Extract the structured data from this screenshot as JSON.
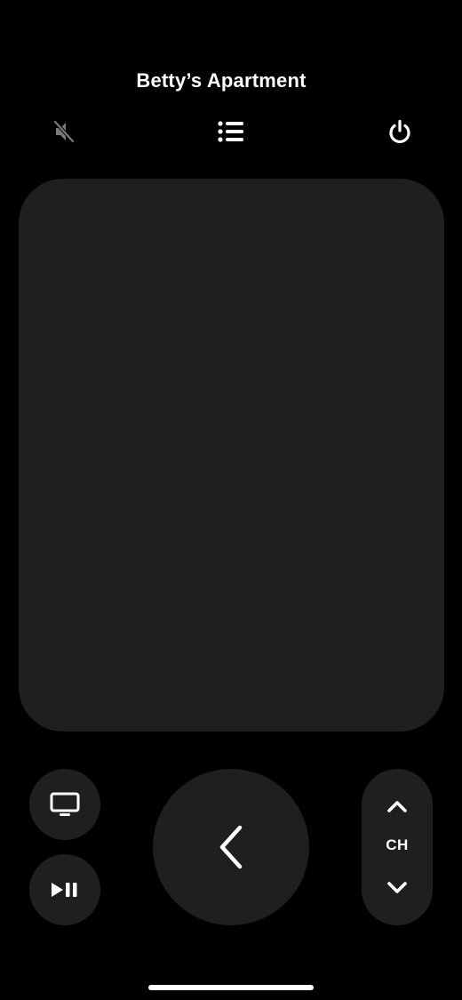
{
  "header": {
    "title": "Betty’s Apartment"
  },
  "top_controls": {
    "mute_icon": "speaker-muted-icon",
    "list_icon": "list-icon",
    "power_icon": "power-icon"
  },
  "touchpad": {
    "icon": ""
  },
  "controls": {
    "tv_icon": "tv-icon",
    "play_pause_icon": "play-pause-icon",
    "back_icon": "chevron-left-icon",
    "channel_label": "CH",
    "channel_up_icon": "chevron-up-icon",
    "channel_down_icon": "chevron-down-icon"
  },
  "colors": {
    "background": "#000000",
    "surface": "#1f1f1f",
    "foreground": "#ffffff",
    "muted_icon": "#7a7a7a"
  }
}
